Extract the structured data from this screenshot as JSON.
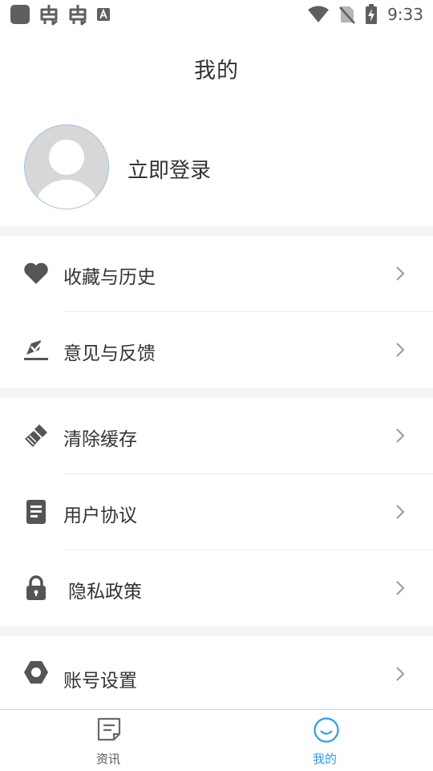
{
  "status_bar": {
    "time": "9:33",
    "left_icons": [
      "app-square-icon",
      "bug-icon",
      "bug-icon",
      "font-a-icon"
    ],
    "right_icons": [
      "wifi-icon",
      "no-sim-icon",
      "battery-charging-icon"
    ]
  },
  "header": {
    "title": "我的"
  },
  "profile": {
    "login_label": "立即登录",
    "avatar_icon": "default-avatar-icon"
  },
  "menu": {
    "groups": [
      {
        "items": [
          {
            "label": "收藏与历史",
            "icon": "heart-icon"
          },
          {
            "label": "意见与反馈",
            "icon": "feedback-icon"
          }
        ]
      },
      {
        "items": [
          {
            "label": "清除缓存",
            "icon": "broom-icon"
          },
          {
            "label": "用户协议",
            "icon": "document-icon"
          },
          {
            "label": "隐私政策",
            "icon": "lock-icon"
          }
        ]
      },
      {
        "items": [
          {
            "label": "账号设置",
            "icon": "hexagon-settings-icon"
          }
        ]
      }
    ]
  },
  "bottom_nav": {
    "items": [
      {
        "label": "资讯",
        "icon": "news-icon",
        "active": false
      },
      {
        "label": "我的",
        "icon": "smile-icon",
        "active": true
      }
    ]
  },
  "colors": {
    "accent": "#2a9df4",
    "icon_gray": "#555555",
    "chevron": "#9a9a9a",
    "background": "#f5f5f5"
  }
}
